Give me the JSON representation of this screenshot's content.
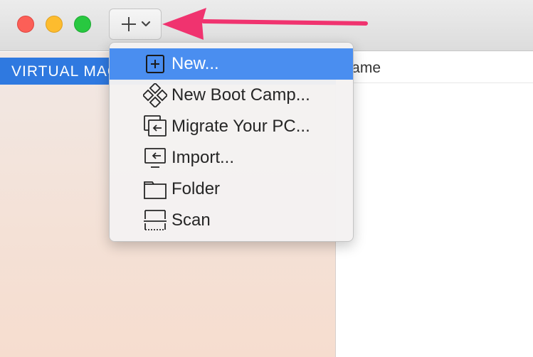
{
  "window": {
    "add_button": {
      "icon": "plus-icon",
      "chevron": "chevron-down-icon"
    }
  },
  "sidebar": {
    "header": "VIRTUAL MAC"
  },
  "content": {
    "column_header": "Name"
  },
  "menu": {
    "items": [
      {
        "label": "New...",
        "icon": "new-plus-square-icon",
        "selected": true
      },
      {
        "label": "New Boot Camp...",
        "icon": "boot-camp-diamond-icon",
        "selected": false
      },
      {
        "label": "Migrate Your PC...",
        "icon": "migrate-pc-icon",
        "selected": false
      },
      {
        "label": "Import...",
        "icon": "import-icon",
        "selected": false
      },
      {
        "label": "Folder",
        "icon": "folder-icon",
        "selected": false
      },
      {
        "label": "Scan",
        "icon": "scan-icon",
        "selected": false
      }
    ]
  },
  "colors": {
    "selection": "#4a8ef0",
    "sidebar_header": "#2f79e0",
    "annotation_arrow": "#f0336f"
  }
}
